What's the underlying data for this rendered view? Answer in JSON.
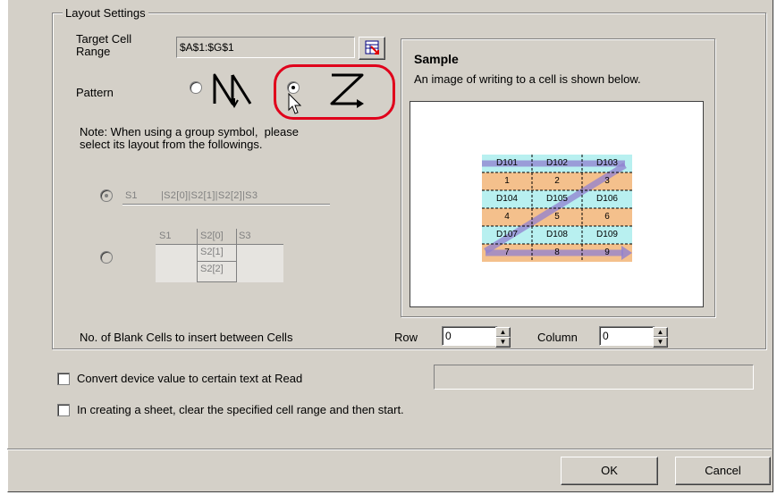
{
  "layout_settings": {
    "legend": "Layout Settings",
    "target_cell_range_label": "Target Cell\nRange",
    "target_cell_range_value": "$A$1:$G$1",
    "pattern_label": "Pattern",
    "note": "Note: When using a group symbol,  please\nselect its layout from the followings.",
    "group_layout_row": [
      "S1",
      "|S2[0]|S2[1]|S2[2]|S3"
    ],
    "group_layout_vertical": {
      "row1": [
        "S1",
        "S2[0]",
        "S3"
      ],
      "row2": "S2[1]",
      "row3": "S2[2]"
    },
    "blank_cells_label": "No. of Blank Cells to insert between Cells",
    "row_label": "Row",
    "row_value": "0",
    "column_label": "Column",
    "column_value": "0"
  },
  "sample": {
    "title": "Sample",
    "description": "An image of writing to a cell is shown below.",
    "grid": [
      [
        "D101",
        "D102",
        "D103"
      ],
      [
        "1",
        "2",
        "3"
      ],
      [
        "D104",
        "D105",
        "D106"
      ],
      [
        "4",
        "5",
        "6"
      ],
      [
        "D107",
        "D108",
        "D109"
      ],
      [
        "7",
        "8",
        "9"
      ]
    ]
  },
  "options": {
    "convert_label": "Convert device value to certain text at Read",
    "clear_label": "In creating a sheet, clear the specified cell range and then start."
  },
  "buttons": {
    "ok": "OK",
    "cancel": "Cancel"
  },
  "colors": {
    "highlight_ring": "#e0001b",
    "cyan_row": "#b8f0f0",
    "peach_row": "#f4c08c",
    "arrow": "#9080d0"
  }
}
